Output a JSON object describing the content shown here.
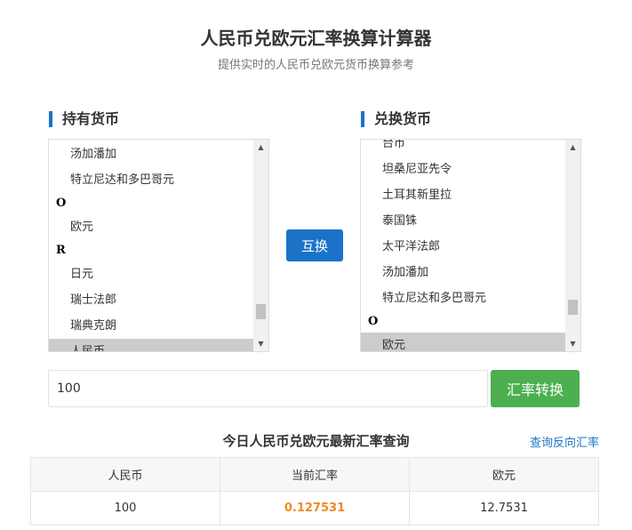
{
  "header": {
    "title": "人民币兑欧元汇率换算计算器",
    "subtitle": "提供实时的人民币兑欧元货币换算参考"
  },
  "from_panel": {
    "heading": "持有货币",
    "options": [
      {
        "label": "汤加潘加",
        "type": "option",
        "selected": false
      },
      {
        "label": "特立尼达和多巴哥元",
        "type": "option",
        "selected": false
      },
      {
        "label": "O",
        "type": "group",
        "selected": false
      },
      {
        "label": "欧元",
        "type": "option",
        "selected": false
      },
      {
        "label": "R",
        "type": "group",
        "selected": false
      },
      {
        "label": "日元",
        "type": "option",
        "selected": false
      },
      {
        "label": "瑞士法郎",
        "type": "option",
        "selected": false
      },
      {
        "label": "瑞典克朗",
        "type": "option",
        "selected": false
      },
      {
        "label": "人民币",
        "type": "option",
        "selected": true
      }
    ]
  },
  "to_panel": {
    "heading": "兑换货币",
    "options": [
      {
        "label": "台币",
        "type": "option",
        "selected": false
      },
      {
        "label": "坦桑尼亚先令",
        "type": "option",
        "selected": false
      },
      {
        "label": "土耳其新里拉",
        "type": "option",
        "selected": false
      },
      {
        "label": "泰国铢",
        "type": "option",
        "selected": false
      },
      {
        "label": "太平洋法郎",
        "type": "option",
        "selected": false
      },
      {
        "label": "汤加潘加",
        "type": "option",
        "selected": false
      },
      {
        "label": "特立尼达和多巴哥元",
        "type": "option",
        "selected": false
      },
      {
        "label": "O",
        "type": "group",
        "selected": false
      },
      {
        "label": "欧元",
        "type": "option",
        "selected": true
      }
    ]
  },
  "controls": {
    "swap_label": "互换",
    "amount_value": "100",
    "convert_label": "汇率转换"
  },
  "results": {
    "title": "今日人民币兑欧元最新汇率查询",
    "reverse_link": "查询反向汇率",
    "columns": [
      "人民币",
      "当前汇率",
      "欧元"
    ],
    "row": {
      "amount": "100",
      "rate": "0.127531",
      "converted": "12.7531"
    }
  },
  "colors": {
    "accent_blue": "#1a73c9",
    "convert_green": "#4caf50",
    "rate_orange": "#f08a24",
    "selected_gray": "#cccccc"
  }
}
